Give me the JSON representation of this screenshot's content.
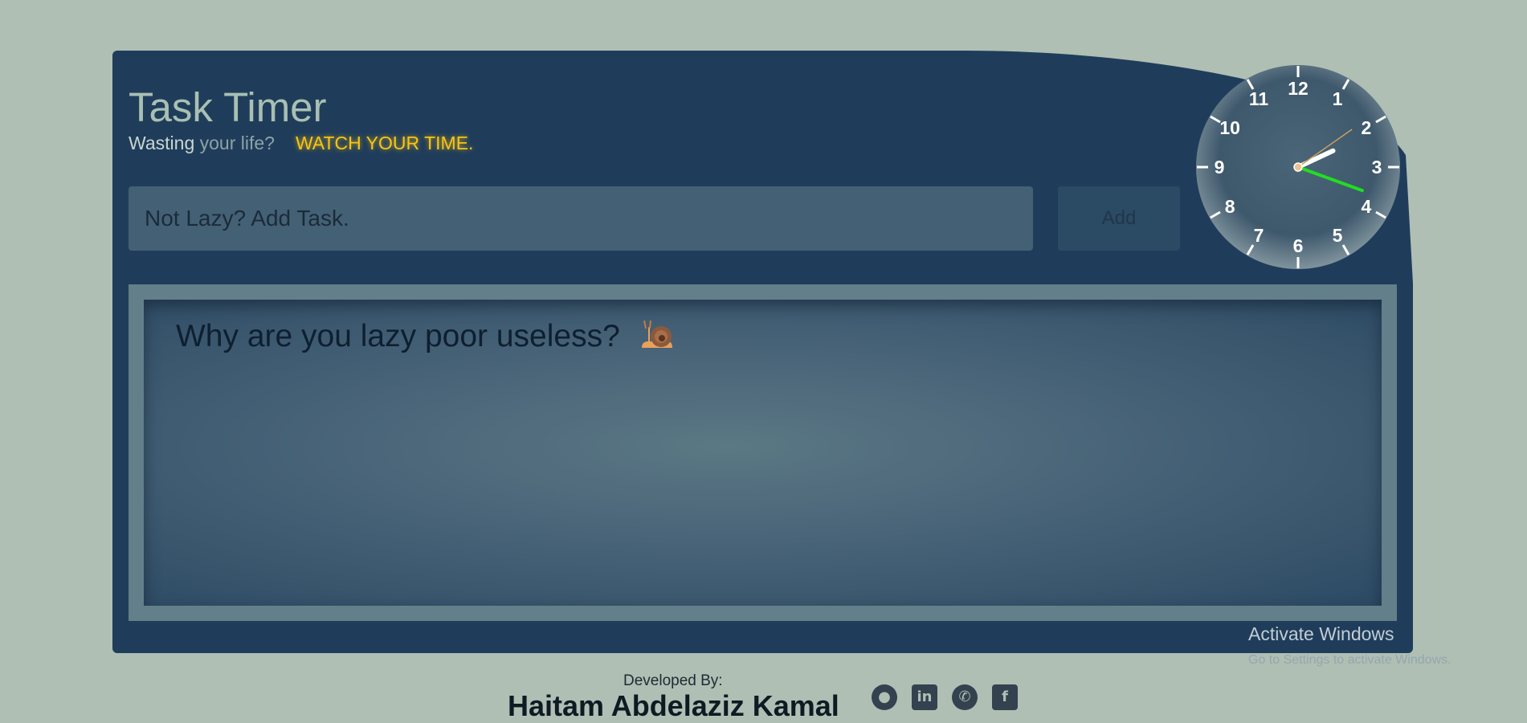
{
  "app": {
    "title": "Task Timer",
    "tagline_part1": "Wasting",
    "tagline_part2": " your life?",
    "tagline_part3": "WATCH YOUR TIME."
  },
  "task_input": {
    "placeholder": "Not Lazy? Add Task.",
    "value": ""
  },
  "add_button": {
    "label": "Add"
  },
  "clock": {
    "numbers": [
      "12",
      "1",
      "2",
      "3",
      "4",
      "5",
      "6",
      "7",
      "8",
      "9",
      "10",
      "11"
    ],
    "hour_hand_angle_deg": 65,
    "minute_hand_angle_deg": 110,
    "second_hand_angle_deg": 55
  },
  "tasks": {
    "empty_message": "Why are you lazy poor useless?",
    "empty_emoji": "snail-icon"
  },
  "footer": {
    "developed_by": "Developed By:",
    "developer_name": "Haitam Abdelaziz Kamal",
    "socials": [
      {
        "name": "github-icon",
        "glyph": "⚫"
      },
      {
        "name": "linkedin-icon",
        "glyph": "in"
      },
      {
        "name": "whatsapp-icon",
        "glyph": "✆"
      },
      {
        "name": "facebook-icon",
        "glyph": "f"
      }
    ]
  },
  "os_overlay": {
    "line1": "Activate Windows",
    "line2": "Go to Settings to activate Windows."
  },
  "colors": {
    "page_bg": "#afbfb4",
    "card_bg": "#1f3d5b",
    "accent_yellow": "#f5c518",
    "second_hand": "#22dd22"
  }
}
